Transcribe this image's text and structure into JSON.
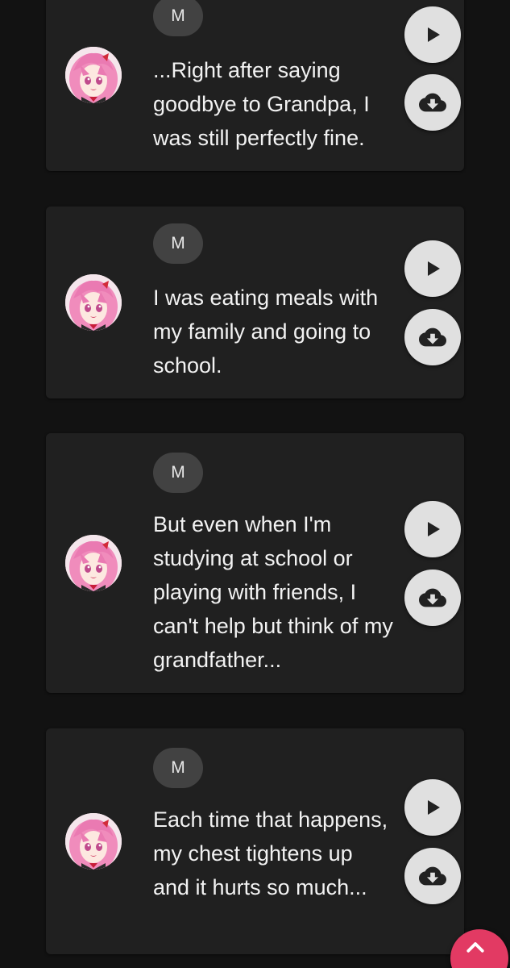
{
  "colors": {
    "background": "#121212",
    "card": "#202020",
    "chip": "#424242",
    "button": "#e0e0e0",
    "fab": "#e23a63"
  },
  "messages": [
    {
      "speaker_initial": "M",
      "text": "...Right after saying goodbye to Grandpa, I was still perfectly fine.",
      "play_icon": "play-icon",
      "download_icon": "cloud-download-icon"
    },
    {
      "speaker_initial": "M",
      "text": "I was eating meals with my family and going to school.",
      "play_icon": "play-icon",
      "download_icon": "cloud-download-icon"
    },
    {
      "speaker_initial": "M",
      "text": "But even when I'm studying at school or playing with friends, I can't help but think of my grandfather...",
      "play_icon": "play-icon",
      "download_icon": "cloud-download-icon"
    },
    {
      "speaker_initial": "M",
      "text": "Each time that happens, my chest tightens up and it hurts so much...",
      "play_icon": "play-icon",
      "download_icon": "cloud-download-icon"
    }
  ],
  "scroll_top_icon": "chevron-up-icon"
}
